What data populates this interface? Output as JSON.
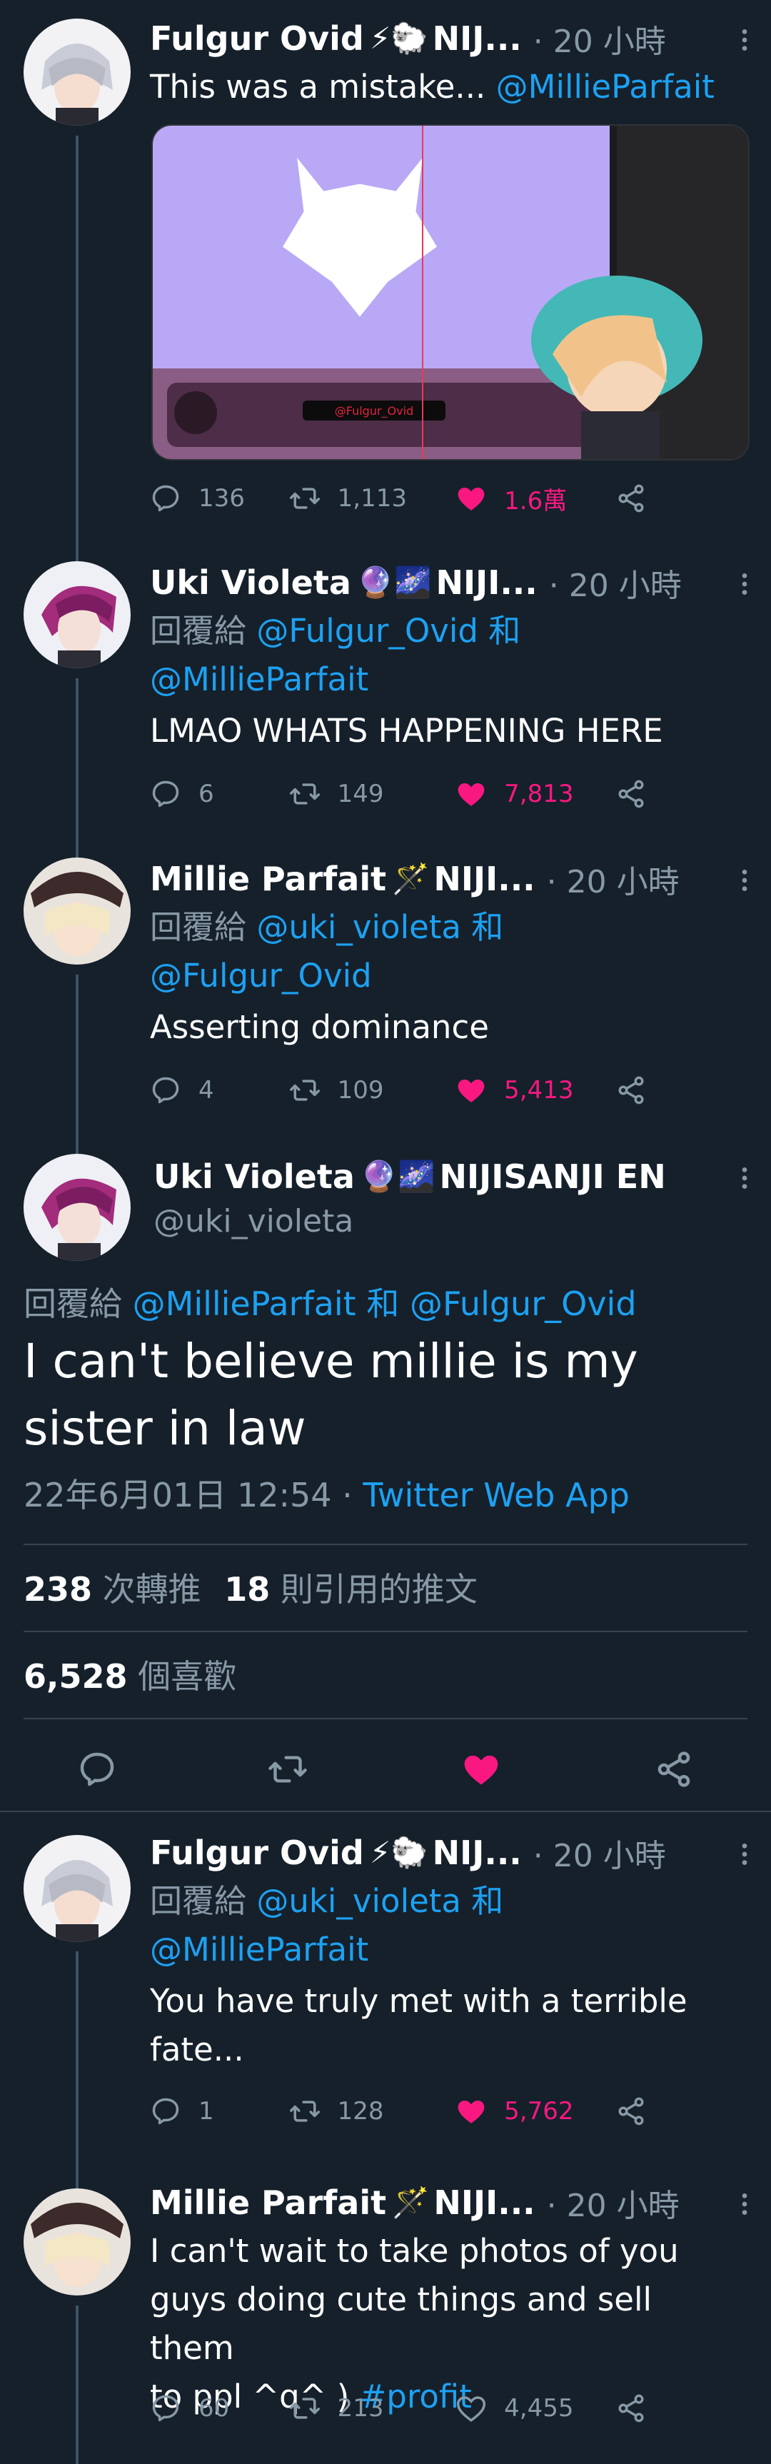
{
  "colors": {
    "bg": "#15202b",
    "text": "#ffffff",
    "muted": "#8899a6",
    "link": "#1da1f2",
    "like": "#f91880",
    "divider": "#38444d"
  },
  "tweets": [
    {
      "name": "Fulgur Ovid",
      "emoji": "⚡🐑",
      "tag": "NIJ...",
      "time": "· 20 小時",
      "text_prefix": "This was a mistake...",
      "mention": "@MillieParfait",
      "media_label": "@Fulgur_Ovid",
      "replies": "136",
      "retweets": "1,113",
      "likes": "1.6萬"
    },
    {
      "name": "Uki Violeta",
      "emoji": "🔮🌌",
      "tag": "NIJI...",
      "time": "· 20 小時",
      "reply_label": "回覆給",
      "mention1": "@Fulgur_Ovid",
      "and": "和",
      "mention2": "@MillieParfait",
      "text": "LMAO WHATS HAPPENING HERE",
      "replies": "6",
      "retweets": "149",
      "likes": "7,813"
    },
    {
      "name": "Millie Parfait",
      "emoji": "🪄",
      "tag": "NIJI...",
      "time": "· 20 小時",
      "reply_label": "回覆給",
      "mention1": "@uki_violeta",
      "and": "和",
      "mention2": "@Fulgur_Ovid",
      "text": "Asserting dominance",
      "replies": "4",
      "retweets": "109",
      "likes": "5,413"
    }
  ],
  "main_tweet": {
    "name": "Uki Violeta",
    "emoji": "🔮🌌",
    "tag": "NIJISANJI EN",
    "handle": "@uki_violeta",
    "reply_label": "回覆給",
    "mention1": "@MillieParfait",
    "and": "和",
    "mention2": "@Fulgur_Ovid",
    "text_line1": "I can't believe millie is my",
    "text_line2": "sister in law",
    "timestamp": "22年6月01日 12:54",
    "dot": "·",
    "source": "Twitter Web App",
    "retweet_count": "238",
    "retweet_label": "次轉推",
    "quote_count": "18",
    "quote_label": "則引用的推文",
    "like_count": "6,528",
    "like_label": "個喜歡"
  },
  "replies": [
    {
      "name": "Fulgur Ovid",
      "emoji": "⚡🐑",
      "tag": "NIJ...",
      "time": "· 20 小時",
      "reply_label": "回覆給",
      "mention1": "@uki_violeta",
      "and": "和",
      "mention2": "@MillieParfait",
      "text_line1": "You have truly met with a terrible",
      "text_line2": "fate...",
      "replies": "1",
      "retweets": "128",
      "likes": "5,762"
    },
    {
      "name": "Millie Parfait",
      "emoji": "🪄",
      "tag": "NIJI...",
      "time": "· 20 小時",
      "text_line1": "I can't wait to take photos of you",
      "text_line2": "guys doing cute things and sell them",
      "text_line3": "to ppl ^q^ )",
      "hashtag": "#profit",
      "replies": "60",
      "retweets": "213",
      "likes": "4,455"
    }
  ]
}
